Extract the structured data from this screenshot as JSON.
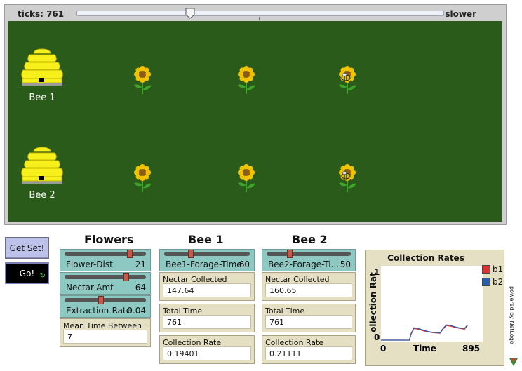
{
  "view": {
    "ticks_label": "ticks: 761",
    "speed_label": "slower",
    "world_color": "#2a5b1a",
    "hives": [
      {
        "label": "Bee 1"
      },
      {
        "label": "Bee 2"
      }
    ]
  },
  "buttons": {
    "get_set": "Get Set!",
    "go": "Go!"
  },
  "sections": {
    "flowers": "Flowers",
    "bee1": "Bee 1",
    "bee2": "Bee 2"
  },
  "flowers": {
    "sliders": [
      {
        "label": "Flower-Dist",
        "value": "21",
        "fraction": 0.82
      },
      {
        "label": "Nectar-Amt",
        "value": "64",
        "fraction": 0.78
      },
      {
        "label": "Extraction-Rate",
        "value": "0.04",
        "fraction": 0.44
      }
    ],
    "monitor": {
      "label": "Mean Time Between",
      "value": "7"
    }
  },
  "bee1": {
    "slider": {
      "label": "Bee1-Forage-Time",
      "value": "60",
      "fraction": 0.3
    },
    "monitors": [
      {
        "label": "Nectar Collected",
        "value": "147.64"
      },
      {
        "label": "Total Time",
        "value": "761"
      },
      {
        "label": "Collection Rate",
        "value": "0.19401"
      }
    ]
  },
  "bee2": {
    "slider": {
      "label": "Bee2-Forage-Ti...",
      "value": "50",
      "fraction": 0.26
    },
    "monitors": [
      {
        "label": "Nectar Collected",
        "value": "160.65"
      },
      {
        "label": "Total Time",
        "value": "761"
      },
      {
        "label": "Collection Rate",
        "value": "0.21111"
      }
    ]
  },
  "chart_data": {
    "type": "line",
    "title": "Collection Rates",
    "xlabel": "Time",
    "ylabel": "ollection Rat",
    "xlim": [
      0,
      895
    ],
    "ylim": [
      0,
      1
    ],
    "x_tick_labels": [
      "0",
      "895"
    ],
    "y_tick_labels": [
      "0",
      "1"
    ],
    "legend_position": "top-right",
    "series": [
      {
        "name": "b1",
        "color": "#e03030",
        "x": [
          0,
          250,
          265,
          290,
          330,
          370,
          410,
          450,
          480,
          520,
          545,
          575,
          615,
          660,
          700,
          735,
          761
        ],
        "y": [
          0,
          0,
          0.08,
          0.16,
          0.15,
          0.13,
          0.115,
          0.105,
          0.1,
          0.095,
          0.15,
          0.2,
          0.19,
          0.17,
          0.16,
          0.15,
          0.2
        ]
      },
      {
        "name": "b2",
        "color": "#2a5fb0",
        "x": [
          0,
          250,
          265,
          290,
          330,
          370,
          410,
          450,
          480,
          520,
          545,
          575,
          615,
          660,
          700,
          735,
          761
        ],
        "y": [
          0,
          0,
          0.09,
          0.17,
          0.16,
          0.14,
          0.12,
          0.11,
          0.105,
          0.1,
          0.16,
          0.21,
          0.2,
          0.18,
          0.165,
          0.16,
          0.21
        ]
      }
    ]
  },
  "footer": {
    "powered_by": "powered by NetLogo"
  }
}
